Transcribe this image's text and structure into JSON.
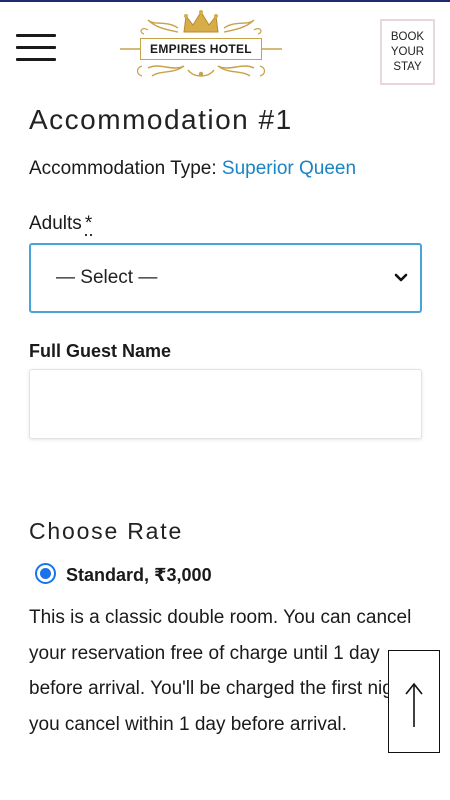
{
  "header": {
    "logo_text": "EMPIRES HOTEL",
    "book_lines": [
      "BOOK",
      "YOUR",
      "STAY"
    ],
    "menu_icon": "hamburger-icon",
    "brand_color": "#c8a24a"
  },
  "accommodation": {
    "title": "Accommodation #1",
    "type_label": "Accommodation Type:",
    "type_value": "Superior Queen",
    "type_color": "#1a84c4"
  },
  "form": {
    "adults_label": "Adults",
    "required_mark": "*",
    "adults_select_value": "— Select —",
    "guest_name_label": "Full Guest Name",
    "guest_name_value": ""
  },
  "rate": {
    "title": "Choose Rate",
    "option_label": "Standard, ₹3,000",
    "selected": true,
    "description": "This is a classic double room. You can cancel your reservation free of charge until 1 day before arrival. You'll be charged the first night if you cancel within 1 day before arrival."
  },
  "scroll_top_icon": "arrow-up-icon"
}
